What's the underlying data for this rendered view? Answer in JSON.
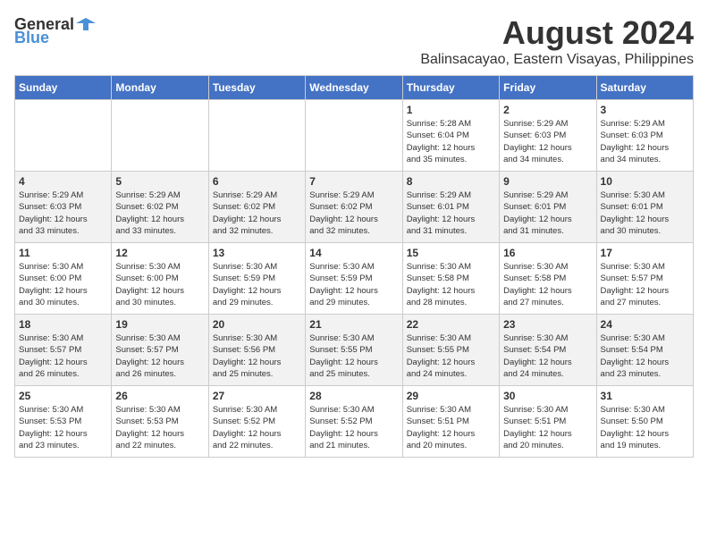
{
  "logo": {
    "text_general": "General",
    "text_blue": "Blue"
  },
  "header": {
    "title": "August 2024",
    "subtitle": "Balinsacayao, Eastern Visayas, Philippines"
  },
  "calendar": {
    "days_of_week": [
      "Sunday",
      "Monday",
      "Tuesday",
      "Wednesday",
      "Thursday",
      "Friday",
      "Saturday"
    ],
    "weeks": [
      [
        {
          "day": "",
          "info": ""
        },
        {
          "day": "",
          "info": ""
        },
        {
          "day": "",
          "info": ""
        },
        {
          "day": "",
          "info": ""
        },
        {
          "day": "1",
          "info": "Sunrise: 5:28 AM\nSunset: 6:04 PM\nDaylight: 12 hours\nand 35 minutes."
        },
        {
          "day": "2",
          "info": "Sunrise: 5:29 AM\nSunset: 6:03 PM\nDaylight: 12 hours\nand 34 minutes."
        },
        {
          "day": "3",
          "info": "Sunrise: 5:29 AM\nSunset: 6:03 PM\nDaylight: 12 hours\nand 34 minutes."
        }
      ],
      [
        {
          "day": "4",
          "info": "Sunrise: 5:29 AM\nSunset: 6:03 PM\nDaylight: 12 hours\nand 33 minutes."
        },
        {
          "day": "5",
          "info": "Sunrise: 5:29 AM\nSunset: 6:02 PM\nDaylight: 12 hours\nand 33 minutes."
        },
        {
          "day": "6",
          "info": "Sunrise: 5:29 AM\nSunset: 6:02 PM\nDaylight: 12 hours\nand 32 minutes."
        },
        {
          "day": "7",
          "info": "Sunrise: 5:29 AM\nSunset: 6:02 PM\nDaylight: 12 hours\nand 32 minutes."
        },
        {
          "day": "8",
          "info": "Sunrise: 5:29 AM\nSunset: 6:01 PM\nDaylight: 12 hours\nand 31 minutes."
        },
        {
          "day": "9",
          "info": "Sunrise: 5:29 AM\nSunset: 6:01 PM\nDaylight: 12 hours\nand 31 minutes."
        },
        {
          "day": "10",
          "info": "Sunrise: 5:30 AM\nSunset: 6:01 PM\nDaylight: 12 hours\nand 30 minutes."
        }
      ],
      [
        {
          "day": "11",
          "info": "Sunrise: 5:30 AM\nSunset: 6:00 PM\nDaylight: 12 hours\nand 30 minutes."
        },
        {
          "day": "12",
          "info": "Sunrise: 5:30 AM\nSunset: 6:00 PM\nDaylight: 12 hours\nand 30 minutes."
        },
        {
          "day": "13",
          "info": "Sunrise: 5:30 AM\nSunset: 5:59 PM\nDaylight: 12 hours\nand 29 minutes."
        },
        {
          "day": "14",
          "info": "Sunrise: 5:30 AM\nSunset: 5:59 PM\nDaylight: 12 hours\nand 29 minutes."
        },
        {
          "day": "15",
          "info": "Sunrise: 5:30 AM\nSunset: 5:58 PM\nDaylight: 12 hours\nand 28 minutes."
        },
        {
          "day": "16",
          "info": "Sunrise: 5:30 AM\nSunset: 5:58 PM\nDaylight: 12 hours\nand 27 minutes."
        },
        {
          "day": "17",
          "info": "Sunrise: 5:30 AM\nSunset: 5:57 PM\nDaylight: 12 hours\nand 27 minutes."
        }
      ],
      [
        {
          "day": "18",
          "info": "Sunrise: 5:30 AM\nSunset: 5:57 PM\nDaylight: 12 hours\nand 26 minutes."
        },
        {
          "day": "19",
          "info": "Sunrise: 5:30 AM\nSunset: 5:57 PM\nDaylight: 12 hours\nand 26 minutes."
        },
        {
          "day": "20",
          "info": "Sunrise: 5:30 AM\nSunset: 5:56 PM\nDaylight: 12 hours\nand 25 minutes."
        },
        {
          "day": "21",
          "info": "Sunrise: 5:30 AM\nSunset: 5:55 PM\nDaylight: 12 hours\nand 25 minutes."
        },
        {
          "day": "22",
          "info": "Sunrise: 5:30 AM\nSunset: 5:55 PM\nDaylight: 12 hours\nand 24 minutes."
        },
        {
          "day": "23",
          "info": "Sunrise: 5:30 AM\nSunset: 5:54 PM\nDaylight: 12 hours\nand 24 minutes."
        },
        {
          "day": "24",
          "info": "Sunrise: 5:30 AM\nSunset: 5:54 PM\nDaylight: 12 hours\nand 23 minutes."
        }
      ],
      [
        {
          "day": "25",
          "info": "Sunrise: 5:30 AM\nSunset: 5:53 PM\nDaylight: 12 hours\nand 23 minutes."
        },
        {
          "day": "26",
          "info": "Sunrise: 5:30 AM\nSunset: 5:53 PM\nDaylight: 12 hours\nand 22 minutes."
        },
        {
          "day": "27",
          "info": "Sunrise: 5:30 AM\nSunset: 5:52 PM\nDaylight: 12 hours\nand 22 minutes."
        },
        {
          "day": "28",
          "info": "Sunrise: 5:30 AM\nSunset: 5:52 PM\nDaylight: 12 hours\nand 21 minutes."
        },
        {
          "day": "29",
          "info": "Sunrise: 5:30 AM\nSunset: 5:51 PM\nDaylight: 12 hours\nand 20 minutes."
        },
        {
          "day": "30",
          "info": "Sunrise: 5:30 AM\nSunset: 5:51 PM\nDaylight: 12 hours\nand 20 minutes."
        },
        {
          "day": "31",
          "info": "Sunrise: 5:30 AM\nSunset: 5:50 PM\nDaylight: 12 hours\nand 19 minutes."
        }
      ]
    ]
  }
}
